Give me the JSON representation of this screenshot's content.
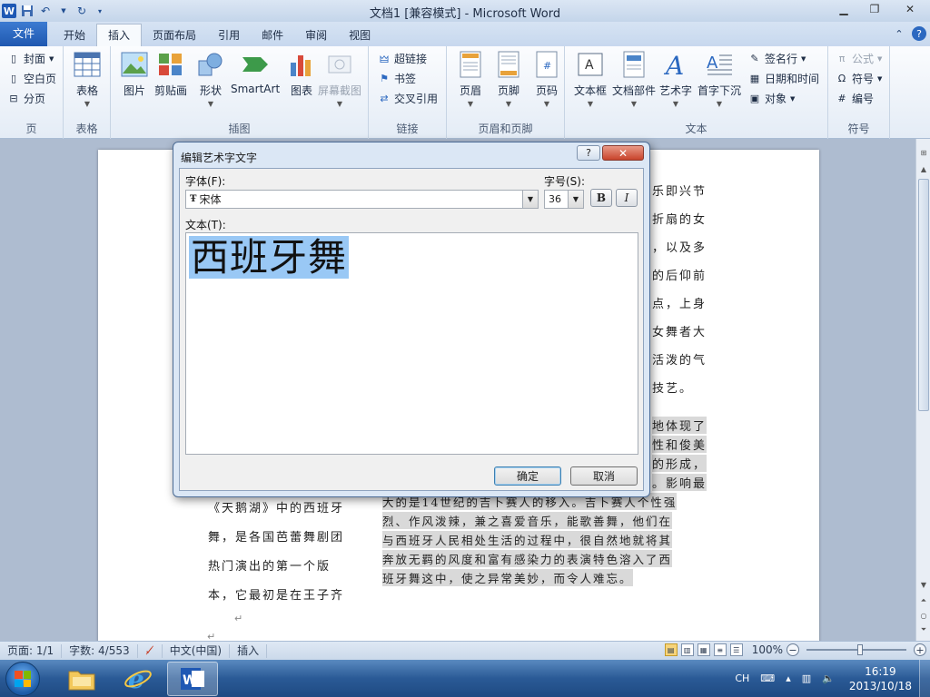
{
  "window": {
    "title": "文档1 [兼容模式] - Microsoft Word",
    "minimize": "▁",
    "restore": "❐",
    "close": "✕"
  },
  "qat": {
    "app_icon": "W",
    "save_icon": "save-icon",
    "undo_icon": "undo-icon",
    "redo_icon": "redo-icon"
  },
  "tabs": {
    "file": "文件",
    "home": "开始",
    "insert": "插入",
    "layout": "页面布局",
    "references": "引用",
    "mailings": "邮件",
    "review": "审阅",
    "view": "视图"
  },
  "ribbon": {
    "pages": {
      "cover": "封面",
      "blank": "空白页",
      "break": "分页",
      "label": "页"
    },
    "tables": {
      "table": "表格",
      "label": "表格"
    },
    "illustrations": {
      "picture": "图片",
      "clipart": "剪贴画",
      "shapes": "形状",
      "smartart": "SmartArt",
      "chart": "图表",
      "screenshot": "屏幕截图",
      "label": "插图"
    },
    "links": {
      "hyperlink": "超链接",
      "bookmark": "书签",
      "crossref": "交叉引用",
      "label": "链接"
    },
    "header_footer": {
      "header": "页眉",
      "footer": "页脚",
      "page_number": "页码",
      "label": "页眉和页脚"
    },
    "text": {
      "textbox": "文本框",
      "quickparts": "文档部件",
      "wordart": "艺术字",
      "dropcap": "首字下沉",
      "signature": "签名行",
      "datetime": "日期和时间",
      "object": "对象",
      "label": "文本"
    },
    "symbols": {
      "equation": "公式",
      "symbol": "符号",
      "number": "编号",
      "label": "符号"
    }
  },
  "document": {
    "right_lines": [
      "乐即兴节",
      "折扇的女",
      "，以及多",
      "的后仰前",
      "点，上身",
      "女舞者大",
      "活泼的气",
      "技艺。"
    ],
    "right_highlight_lines": [
      "地体现了",
      "性和俊美",
      "的形成，",
      "。影响最"
    ],
    "bottom_full_lines": [
      "大的是14世纪的吉卜赛人的移入。吉卜赛人个性强",
      "烈、作风泼辣，兼之喜爱音乐，能歌善舞，他们在",
      "与西班牙人民相处生活的过程中，很自然地就将其",
      "奔放无羁的风度和富有感染力的表演特色溶入了西",
      "班牙舞这中，使之异常美妙，而令人难忘。"
    ],
    "left_lines": [
      "《天鹅湖》中的西班牙",
      "舞，是各国芭蕾舞剧团",
      "热门演出的第一个版",
      "本，它最初是在王子齐"
    ]
  },
  "dialog": {
    "title": "编辑艺术字文字",
    "help": "?",
    "close": "✕",
    "font_label": "字体(F):",
    "font_value": "宋体",
    "size_label": "字号(S):",
    "size_value": "36",
    "bold": "B",
    "italic": "I",
    "text_label": "文本(T):",
    "text_value": "西班牙舞",
    "ok": "确定",
    "cancel": "取消"
  },
  "status": {
    "page": "页面: 1/1",
    "words": "字数: 4/553",
    "language": "中文(中国)",
    "mode": "插入",
    "zoom": "100%"
  },
  "taskbar": {
    "ime": "CH",
    "time": "16:19",
    "date": "2013/10/18"
  },
  "colors": {
    "selection": "#99c8f5",
    "file_tab": "#1f58b0",
    "dialog_close": "#c8432b"
  }
}
